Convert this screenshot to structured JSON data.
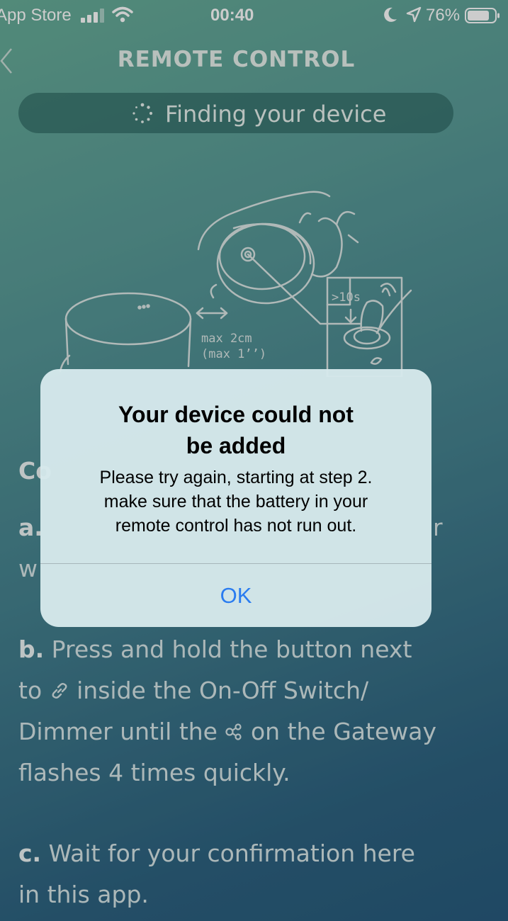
{
  "status_bar": {
    "carrier": "App Store",
    "time": "00:40",
    "battery_pct": "76%",
    "icons": [
      "signal-icon",
      "wifi-icon",
      "moon-icon",
      "location-arrow-icon",
      "battery-icon"
    ]
  },
  "nav": {
    "back_icon": "chevron-left-icon",
    "title": "REMOTE CONTROL"
  },
  "finding": {
    "icon": "spinner-icon",
    "label": "Finding your device"
  },
  "illustration": {
    "distance_label": "max 2cm",
    "distance_label_inch": "(max 1’’)",
    "hold_label": ">10s"
  },
  "steps": {
    "c_partial": "Co",
    "a_marker": "a.",
    "a_partial_right": "r",
    "a_line2_partial": "w",
    "b_marker": "b.",
    "b_line1": "Press and hold the button next",
    "b_line2_pre": "to",
    "b_line2_post": "inside the On-Off Switch/",
    "b_line3_pre": "Dimmer until the",
    "b_line3_post": "on the Gateway",
    "b_line4": "flashes 4 times quickly.",
    "c_marker": "c.",
    "c_line1": "Wait for your confirmation here",
    "c_line2": "in this app."
  },
  "alert": {
    "title_line1": "Your device could not",
    "title_line2": "be added",
    "message_line1": "Please try again, starting at step 2.",
    "message_line2": "make sure that the battery in your",
    "message_line3": "remote control has not run out.",
    "ok_label": "OK",
    "accent_color": "#2a7cf0"
  }
}
